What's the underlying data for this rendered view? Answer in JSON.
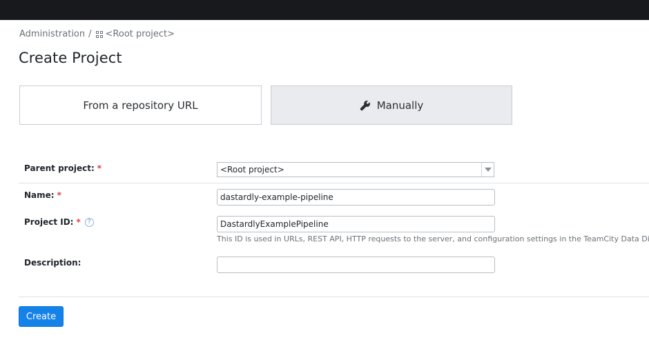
{
  "breadcrumb": {
    "admin": "Administration",
    "separator": "/",
    "project_icon": "project-grid-icon",
    "current": "<Root project>"
  },
  "page_title": "Create Project",
  "mode_tabs": {
    "repo": {
      "label": "From a repository URL",
      "selected": false
    },
    "manual": {
      "label": "Manually",
      "icon": "wrench-icon",
      "selected": true
    }
  },
  "form": {
    "parent_project": {
      "label": "Parent project:",
      "required_mark": "*",
      "value": "<Root project>"
    },
    "name": {
      "label": "Name:",
      "required_mark": "*",
      "value": "dastardly-example-pipeline"
    },
    "project_id": {
      "label": "Project ID:",
      "required_mark": "*",
      "help": "?",
      "value": "DastardlyExamplePipeline",
      "hint": "This ID is used in URLs, REST API, HTTP requests to the server, and configuration settings in the TeamCity Data Directory."
    },
    "description": {
      "label": "Description:",
      "value": ""
    }
  },
  "actions": {
    "create_label": "Create"
  },
  "colors": {
    "topbar": "#18191c",
    "primary": "#1482e8",
    "required": "#e03a3e",
    "selected_tab": "#eaebee"
  }
}
